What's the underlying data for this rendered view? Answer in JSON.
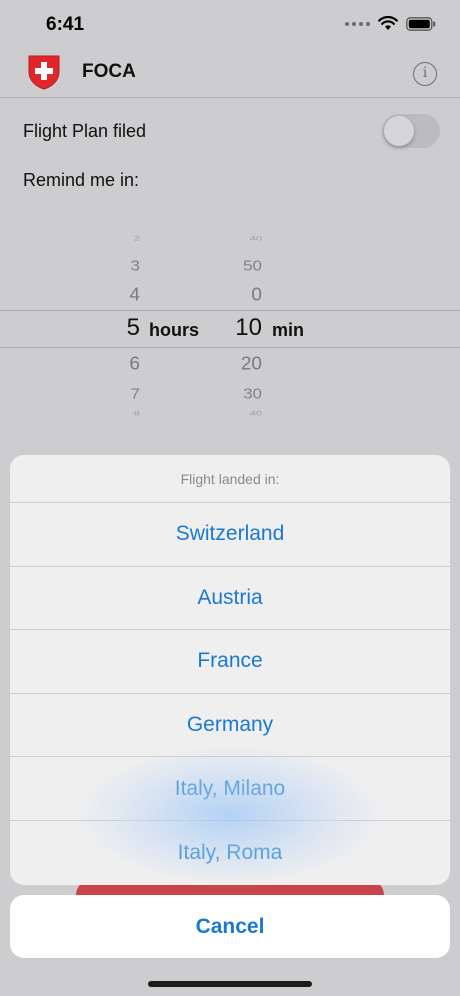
{
  "status_bar": {
    "time": "6:41"
  },
  "nav": {
    "title": "FOCA",
    "info_label": "i"
  },
  "settings": {
    "flight_plan_label": "Flight Plan filed",
    "flight_plan_on": false,
    "remind_label": "Remind me in:"
  },
  "picker": {
    "hours": [
      "2",
      "3",
      "4",
      "5",
      "6",
      "7",
      "8"
    ],
    "minutes": [
      "40",
      "50",
      "0",
      "10",
      "20",
      "30",
      "40"
    ],
    "hours_unit": "hours",
    "minutes_unit": "min",
    "selected_hours": "5",
    "selected_minutes": "10"
  },
  "action_sheet": {
    "header": "Flight landed in:",
    "options": [
      "Switzerland",
      "Austria",
      "France",
      "Germany",
      "Italy, Milano",
      "Italy, Roma"
    ],
    "cancel_label": "Cancel"
  },
  "colors": {
    "accent": "#1a7ad1",
    "logo_red": "#e0262b",
    "button_red": "#c9434a"
  }
}
